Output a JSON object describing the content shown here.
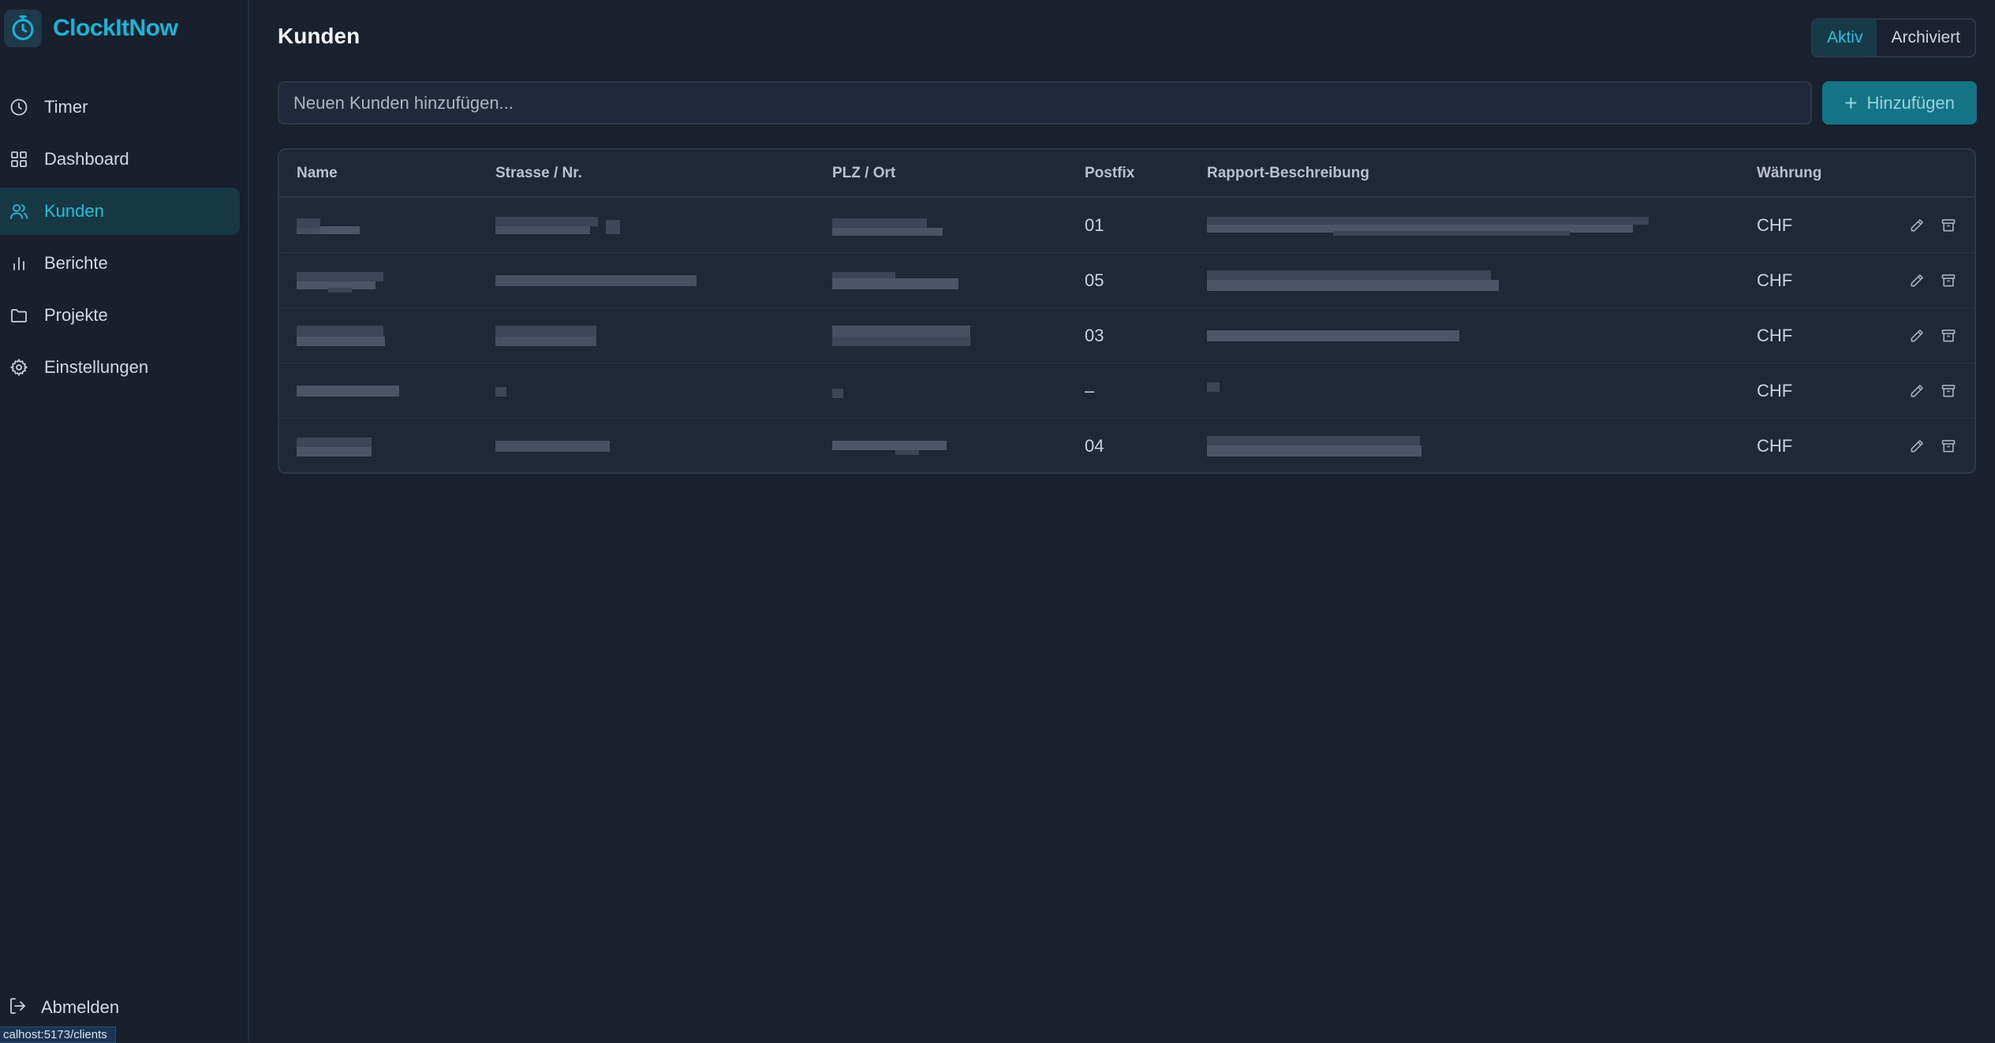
{
  "app": {
    "name": "ClockItNow",
    "accent": "#1cb3d4"
  },
  "sidebar": {
    "items": [
      {
        "label": "Timer",
        "icon": "clock-icon",
        "active": false
      },
      {
        "label": "Dashboard",
        "icon": "grid-icon",
        "active": false
      },
      {
        "label": "Kunden",
        "icon": "users-icon",
        "active": true
      },
      {
        "label": "Berichte",
        "icon": "bar-chart-icon",
        "active": false
      },
      {
        "label": "Projekte",
        "icon": "folder-icon",
        "active": false
      },
      {
        "label": "Einstellungen",
        "icon": "gear-icon",
        "active": false
      }
    ],
    "logout_label": "Abmelden"
  },
  "status_bar": {
    "url": "calhost:5173/clients"
  },
  "page": {
    "title": "Kunden",
    "filter": {
      "active_label": "Aktiv",
      "archived_label": "Archiviert",
      "selected": "Aktiv"
    },
    "add": {
      "placeholder": "Neuen Kunden hinzufügen...",
      "button_label": "Hinzufügen"
    }
  },
  "table": {
    "headers": {
      "name": "Name",
      "street": "Strasse / Nr.",
      "city": "PLZ / Ort",
      "postfix": "Postfix",
      "description": "Rapport-Beschreibung",
      "currency": "Währung"
    },
    "rows": [
      {
        "postfix": "01",
        "currency": "CHF"
      },
      {
        "postfix": "05",
        "currency": "CHF"
      },
      {
        "postfix": "03",
        "currency": "CHF"
      },
      {
        "postfix": "–",
        "currency": "CHF"
      },
      {
        "postfix": "04",
        "currency": "CHF"
      }
    ]
  }
}
